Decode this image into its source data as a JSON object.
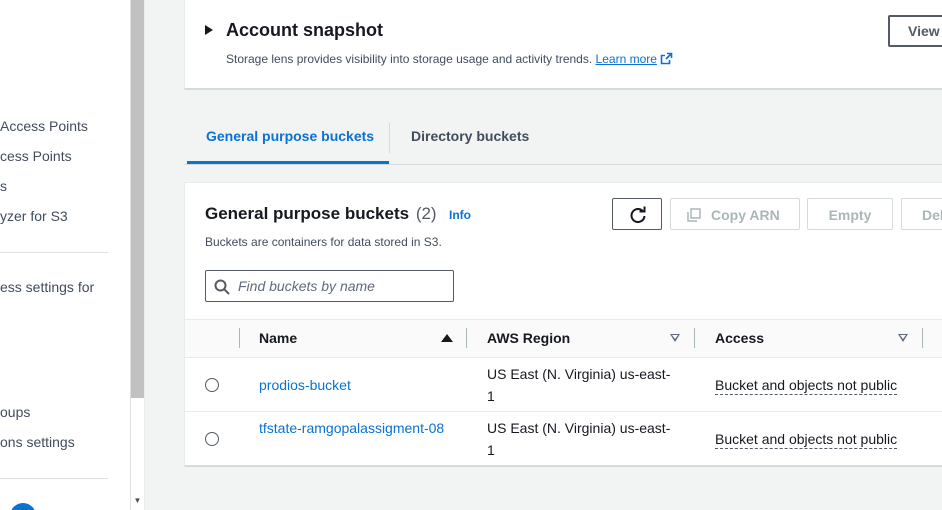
{
  "sidebar": {
    "items": [
      {
        "label": "Access Points"
      },
      {
        "label": "cess Points"
      },
      {
        "label": "s"
      },
      {
        "label": "yzer for S3"
      },
      {
        "label": "ess settings for"
      },
      {
        "label": "oups"
      },
      {
        "label": "ons settings"
      }
    ]
  },
  "snapshot": {
    "title": "Account snapshot",
    "description": "Storage lens provides visibility into storage usage and activity trends.",
    "learn_more": "Learn more",
    "view_button": "View"
  },
  "tabs": [
    {
      "label": "General purpose buckets",
      "active": true
    },
    {
      "label": "Directory buckets",
      "active": false
    }
  ],
  "panel": {
    "title": "General purpose buckets",
    "count": "(2)",
    "info": "Info",
    "description": "Buckets are containers for data stored in S3.",
    "buttons": {
      "copy_arn": "Copy ARN",
      "empty": "Empty",
      "delete": "Del"
    },
    "search_placeholder": "Find buckets by name"
  },
  "table": {
    "columns": [
      "Name",
      "AWS Region",
      "Access"
    ],
    "rows": [
      {
        "name": "prodios-bucket",
        "region": "US East (N. Virginia) us-east-1",
        "access": "Bucket and objects not public"
      },
      {
        "name": "tfstate-ramgopalassigment-08",
        "region": "US East (N. Virginia) us-east-1",
        "access": "Bucket and objects not public"
      }
    ]
  },
  "colors": {
    "accent": "#0972d3",
    "text": "#16191f",
    "disabled": "#aab7b8",
    "background": "#f2f3f3"
  }
}
